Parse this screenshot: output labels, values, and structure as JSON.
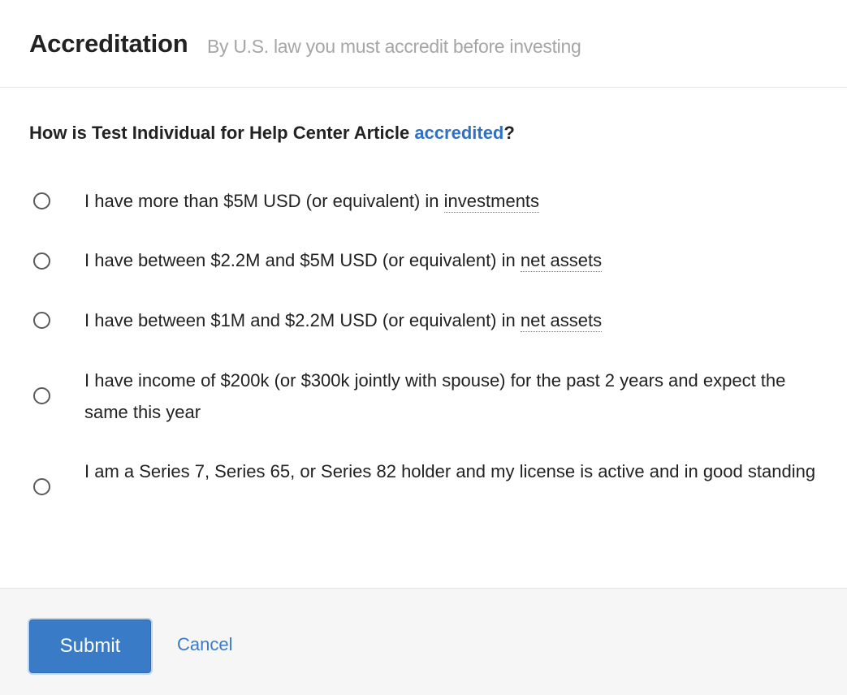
{
  "header": {
    "title": "Accreditation",
    "subtitle": "By U.S. law you must accredit before investing"
  },
  "question": {
    "prefix": "How is Test Individual for Help Center Article ",
    "link": "accredited",
    "suffix": "?"
  },
  "options": [
    {
      "text": "I have more than $5M USD (or equivalent) in ",
      "term": "investments",
      "selected": false
    },
    {
      "text": "I have between $2.2M and $5M USD (or equivalent) in ",
      "term": "net assets",
      "selected": false
    },
    {
      "text": "I have between $1M and $2.2M USD (or equivalent) in ",
      "term": "net assets",
      "selected": false
    },
    {
      "text": "I have income of $200k (or $300k jointly with spouse) for the past 2 years and expect the same this year",
      "selected": false
    },
    {
      "text": "I am a Series 7, Series 65, or Series 82 holder and my license is active and in good standing",
      "selected": false
    }
  ],
  "footer": {
    "submit_label": "Submit",
    "cancel_label": "Cancel"
  },
  "colors": {
    "accent": "#3a7bc8",
    "link": "#2f72c4",
    "subtitle": "#a6a6a6",
    "footer_bg": "#f6f6f6"
  }
}
